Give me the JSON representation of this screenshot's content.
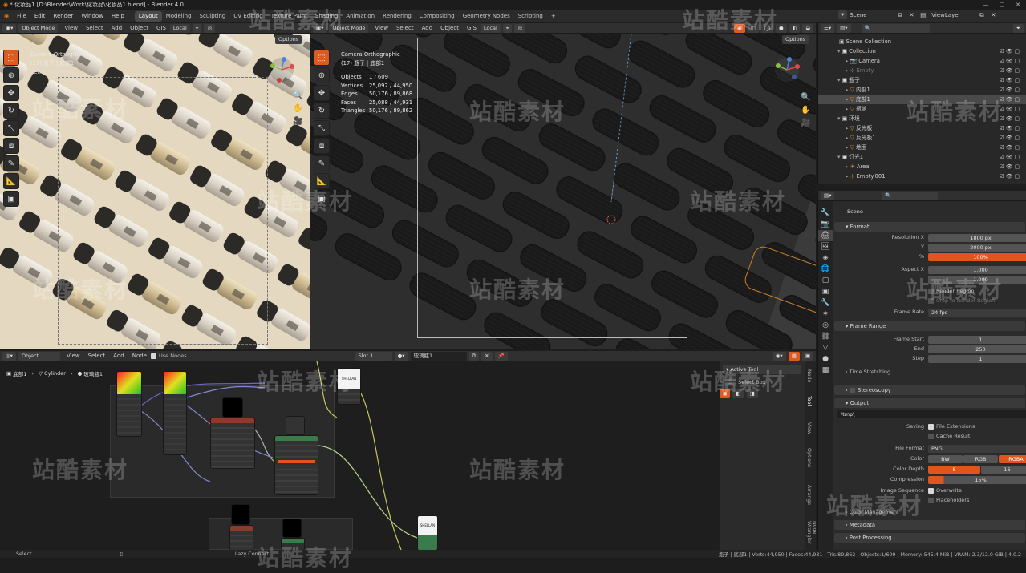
{
  "window": {
    "title": "* 化妆品1 [D:\\Blender\\Work\\化妆品\\化妆品1.blend] - Blender 4.0"
  },
  "menu": [
    "File",
    "Edit",
    "Render",
    "Window",
    "Help"
  ],
  "workspaces": [
    "Layout",
    "Modeling",
    "Sculpting",
    "UV Editing",
    "Texture Paint",
    "Shading",
    "Animation",
    "Rendering",
    "Compositing",
    "Geometry Nodes",
    "Scripting"
  ],
  "scene": {
    "label": "Scene",
    "view_layer": "ViewLayer"
  },
  "viewport_left": {
    "mode": "Object Mode",
    "menus": [
      "View",
      "Select",
      "Add",
      "Object"
    ],
    "gis": "GIS",
    "transform": "Local",
    "options": "Options",
    "camera": "Camera Orthographic",
    "object": "(17) 瓶子 | 底部1",
    "status": "Rendering Done"
  },
  "viewport_right": {
    "mode": "Object Mode",
    "menus": [
      "View",
      "Select",
      "Add",
      "Object"
    ],
    "gis": "GIS",
    "transform": "Local",
    "options": "Options",
    "camera": "Camera Orthographic",
    "object": "(17) 瓶子 | 底部1",
    "stats": [
      [
        "Objects",
        "1 / 609"
      ],
      [
        "Vertices",
        "25,092 / 44,950"
      ],
      [
        "Edges",
        "50,176 / 89,868"
      ],
      [
        "Faces",
        "25,088 / 44,931"
      ],
      [
        "Triangles",
        "50,176 / 89,862"
      ]
    ]
  },
  "outliner": {
    "header": "Scene Collection",
    "rows": [
      {
        "name": "Collection",
        "indent": 1,
        "icon": "collection"
      },
      {
        "name": "Camera",
        "indent": 2,
        "icon": "camera"
      },
      {
        "name": "Empty",
        "indent": 2,
        "icon": "empty",
        "dim": true
      },
      {
        "name": "瓶子",
        "indent": 1,
        "icon": "collection"
      },
      {
        "name": "内部1",
        "indent": 2,
        "icon": "mesh"
      },
      {
        "name": "底部1",
        "indent": 2,
        "icon": "mesh",
        "selected": true
      },
      {
        "name": "瓶盖",
        "indent": 2,
        "icon": "mesh"
      },
      {
        "name": "环境",
        "indent": 1,
        "icon": "collection"
      },
      {
        "name": "反光板",
        "indent": 2,
        "icon": "mesh"
      },
      {
        "name": "反光板1",
        "indent": 2,
        "icon": "mesh"
      },
      {
        "name": "地面",
        "indent": 2,
        "icon": "mesh"
      },
      {
        "name": "灯光1",
        "indent": 1,
        "icon": "collection"
      },
      {
        "name": "Area",
        "indent": 2,
        "icon": "light"
      },
      {
        "name": "Empty.001",
        "indent": 2,
        "icon": "empty"
      }
    ]
  },
  "properties": {
    "scene": "Scene",
    "format": {
      "title": "Format",
      "res_x_label": "Resolution X",
      "res_x": "1800 px",
      "y_label": "Y",
      "res_y": "2000 px",
      "pct_label": "%",
      "pct": "100%",
      "aspect_label": "Aspect X",
      "aspect_x": "1.000",
      "aspect_y": "1.000",
      "render_region": "Render Region",
      "crop": "Crop to Render Region",
      "frame_rate_label": "Frame Rate",
      "frame_rate": "24 fps"
    },
    "frame_range": {
      "title": "Frame Range",
      "start_label": "Frame Start",
      "start": "1",
      "end_label": "End",
      "end": "250",
      "step_label": "Step",
      "step": "1",
      "time_stretching": "Time Stretching"
    },
    "stereoscopy": "Stereoscopy",
    "output": {
      "title": "Output",
      "path": "/tmp\\",
      "saving_label": "Saving",
      "file_ext": "File Extensions",
      "cache": "Cache Result",
      "format_label": "File Format",
      "format": "PNG",
      "color_label": "Color",
      "bw": "BW",
      "rgb": "RGB",
      "rgba": "RGBA",
      "depth_label": "Color Depth",
      "depth_8": "8",
      "depth_16": "16",
      "compression_label": "Compression",
      "compression": "15%",
      "image_seq_label": "Image Sequence",
      "overwrite": "Overwrite",
      "placeholders": "Placeholders",
      "color_mgmt": "Color Management"
    },
    "metadata": "Metadata",
    "post": "Post Processing"
  },
  "node_editor": {
    "mode": "Object",
    "menus": [
      "View",
      "Select",
      "Add",
      "Node"
    ],
    "use_nodes": "Use Nodes",
    "slot": "Slot 1",
    "material": "玻璃瓶1",
    "breadcrumb": [
      "底部1",
      "Cylinder",
      "玻璃瓶1"
    ],
    "sidebar_tabs": [
      "Node",
      "Tool",
      "View",
      "Options",
      "Arrange",
      "Node Wrangler"
    ],
    "active_tool": "Active Tool",
    "select_box": "Select Box",
    "label_brand": "SHELLAN",
    "label_brand2": "SHELLAN"
  },
  "statusbar": {
    "left": "Select",
    "mid": "Lazy Connect",
    "right": "瓶子 | 底部1 | Verts:44,950 | Faces:44,931 | Tris:89,862 | Objects:1/609 | Memory: 545.4 MiB | VRAM: 2.3/12.0 GiB | 4.0.2"
  },
  "watermark": "站酷素材"
}
